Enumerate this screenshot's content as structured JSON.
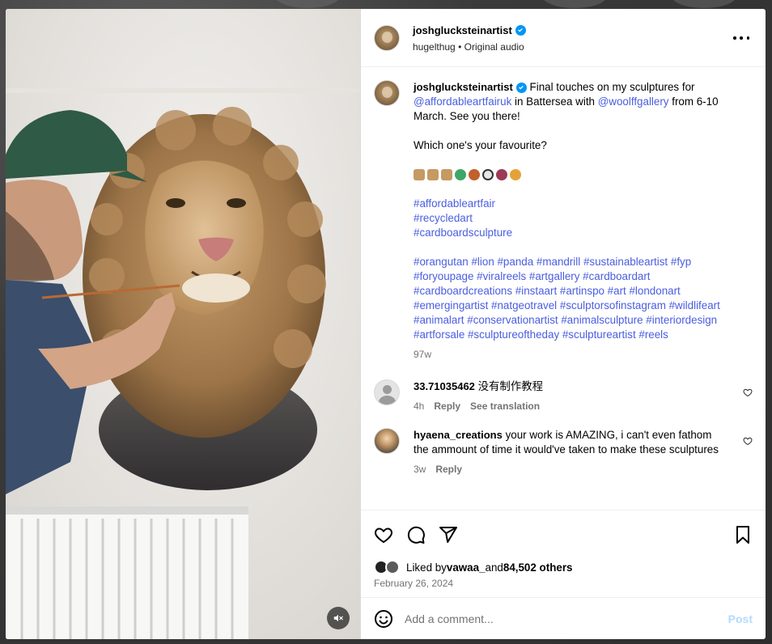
{
  "post": {
    "author": "joshglucksteinartist",
    "audio_user": "hugelthug",
    "audio_sep": "•",
    "audio_label": "Original audio"
  },
  "caption": {
    "author": "joshglucksteinartist",
    "text_1": "Final touches on my sculptures for ",
    "mention_1": "@affordableartfairuk",
    "text_2": " in Battersea with ",
    "mention_2": "@woolffgallery",
    "text_3": " from 6-10 March. See you there!",
    "question": "Which one's your favourite?",
    "emojis": [
      "package",
      "package",
      "package",
      "recycle",
      "orangutan",
      "panda",
      "squirrel",
      "lion"
    ],
    "hashtags_group_1": [
      "#affordableartfair",
      "#recycledart",
      "#cardboardsculpture"
    ],
    "hashtags_group_2": "#orangutan #lion #panda #mandrill #sustainableartist #fyp #foryoupage #viralreels #artgallery #cardboardart #cardboardcreations #instaart #artinspo #art #londonart #emergingartist #natgeotravel #sculptorsofinstagram #wildlifeart #animalart #conservationartist #animalsculpture #interiordesign #artforsale #sculptureoftheday #sculptureartist #reels",
    "age": "97w"
  },
  "comments": [
    {
      "user": "33.71035462",
      "text": "没有制作教程",
      "age": "4h",
      "reply": "Reply",
      "translate": "See translation"
    },
    {
      "user": "hyaena_creations",
      "text": "your work is AMAZING, i can't even fathom the ammount of time it would've taken to make these sculptures",
      "age": "3w",
      "reply": "Reply"
    }
  ],
  "likes": {
    "prefix": "Liked by ",
    "user": "vawaa_",
    "middle": " and ",
    "count": "84,502 others"
  },
  "date": "February 26, 2024",
  "comment_input": {
    "placeholder": "Add a comment...",
    "post_label": "Post"
  },
  "colors": {
    "link": "#4a5de0",
    "verified": "#0095f6",
    "muted": "#737373"
  }
}
